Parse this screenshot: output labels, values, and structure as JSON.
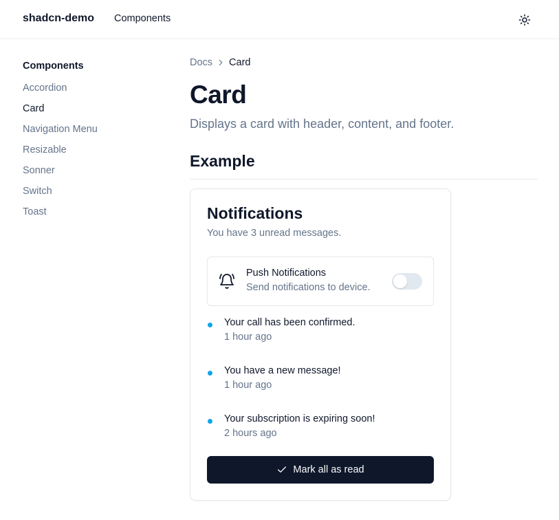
{
  "header": {
    "brand": "shadcn-demo",
    "nav_components": "Components",
    "theme_icon": "sun-icon"
  },
  "sidebar": {
    "title": "Components",
    "items": [
      {
        "label": "Accordion",
        "active": false
      },
      {
        "label": "Card",
        "active": true
      },
      {
        "label": "Navigation Menu",
        "active": false
      },
      {
        "label": "Resizable",
        "active": false
      },
      {
        "label": "Sonner",
        "active": false
      },
      {
        "label": "Switch",
        "active": false
      },
      {
        "label": "Toast",
        "active": false
      }
    ]
  },
  "main": {
    "breadcrumb": {
      "root": "Docs",
      "current": "Card",
      "separator_icon": "chevron-right-icon"
    },
    "title": "Card",
    "description": "Displays a card with header, content, and footer.",
    "section_title": "Example"
  },
  "card": {
    "title": "Notifications",
    "description": "You have 3 unread messages.",
    "push": {
      "icon": "bell-ring-icon",
      "title": "Push Notifications",
      "subtitle": "Send notifications to device.",
      "enabled": false
    },
    "notifications": [
      {
        "title": "Your call has been confirmed.",
        "time": "1 hour ago"
      },
      {
        "title": "You have a new message!",
        "time": "1 hour ago"
      },
      {
        "title": "Your subscription is expiring soon!",
        "time": "2 hours ago"
      }
    ],
    "button": {
      "label": "Mark all as read",
      "icon": "check-icon"
    }
  },
  "colors": {
    "text": "#0f172a",
    "muted": "#64748b",
    "border": "#e5e7eb",
    "accent_dot": "#0ea5e9",
    "button_bg": "#0f172a",
    "switch_off": "#e2e8f0"
  }
}
